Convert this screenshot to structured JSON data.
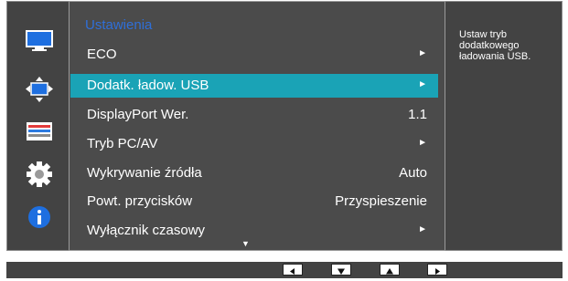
{
  "menu": {
    "title": "Ustawienia",
    "items": [
      {
        "label": "ECO",
        "value": "",
        "has_arrow": true,
        "selected": false
      },
      {
        "label": "Dodatk. ładow. USB",
        "value": "",
        "has_arrow": true,
        "selected": true
      },
      {
        "label": "DisplayPort Wer.",
        "value": "1.1",
        "has_arrow": false,
        "selected": false
      },
      {
        "label": "Tryb PC/AV",
        "value": "",
        "has_arrow": true,
        "selected": false
      },
      {
        "label": "Wykrywanie źródła",
        "value": "Auto",
        "has_arrow": false,
        "selected": false
      },
      {
        "label": "Powt. przycisków",
        "value": "Przyspieszenie",
        "has_arrow": false,
        "selected": false
      },
      {
        "label": "Wyłącznik czasowy",
        "value": "",
        "has_arrow": true,
        "selected": false
      }
    ],
    "arrow_glyph": "►",
    "scroll_down_glyph": "▼"
  },
  "help": {
    "text": "Ustaw tryb dodatkowego ładowania USB."
  },
  "sidebar": {
    "icons": [
      "monitor-icon",
      "size-position-icon",
      "color-bars-icon",
      "settings-gear-icon",
      "info-icon"
    ]
  },
  "nav_buttons": [
    {
      "name": "left",
      "glyph": "◄"
    },
    {
      "name": "down",
      "glyph": "▼"
    },
    {
      "name": "up",
      "glyph": "▲"
    },
    {
      "name": "right",
      "glyph": "►"
    }
  ],
  "colors": {
    "selected_row": "#1aa3b6",
    "title": "#2f6fd8",
    "background": "#434343"
  }
}
